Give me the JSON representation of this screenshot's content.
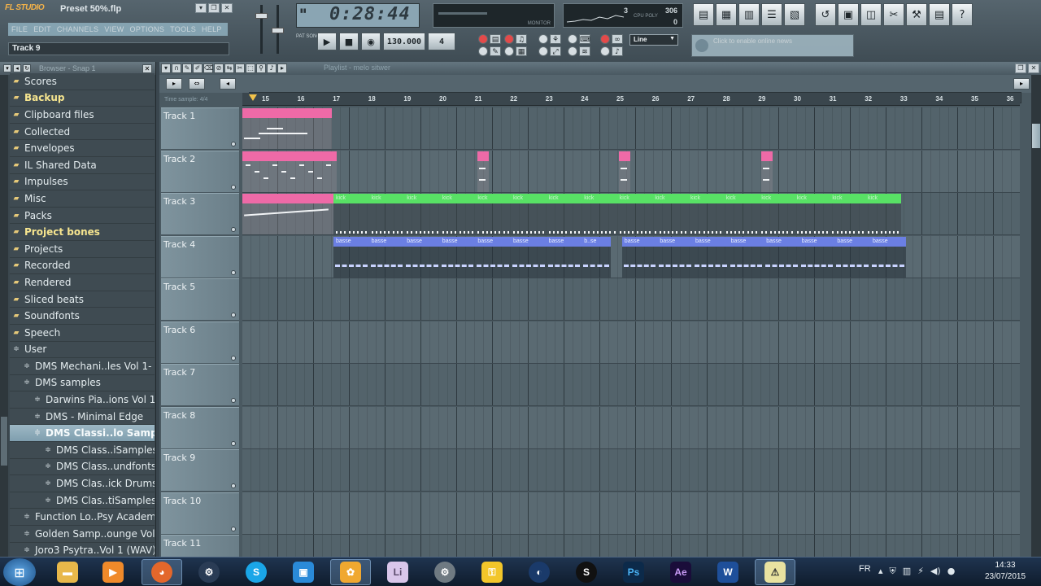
{
  "window": {
    "app_logo": "FL STUDIO",
    "project_title": "Preset 50%.flp",
    "hint_text": "Track 9",
    "menu": [
      "FILE",
      "EDIT",
      "CHANNELS",
      "VIEW",
      "OPTIONS",
      "TOOLS",
      "HELP"
    ]
  },
  "transport": {
    "time": "0:28:44",
    "monitor_label": "MONITOR",
    "cpu_value": "3",
    "ram_value": "306",
    "cpu_label": "CPU POLY",
    "poly_value": "0",
    "pattern_label": "PAT SONG",
    "tempo": "130.000",
    "pattern_number": "4",
    "snap": "Line",
    "news_text": "Click to enable online news"
  },
  "browser": {
    "title": "Browser - Snap 1",
    "items": [
      {
        "label": "Scores",
        "type": "folder",
        "indent": 1
      },
      {
        "label": "Backup",
        "type": "folder",
        "indent": 1,
        "highlight": true
      },
      {
        "label": "Clipboard files",
        "type": "folder",
        "indent": 1
      },
      {
        "label": "Collected",
        "type": "folder",
        "indent": 1
      },
      {
        "label": "Envelopes",
        "type": "folder",
        "indent": 1
      },
      {
        "label": "IL Shared Data",
        "type": "folder",
        "indent": 1
      },
      {
        "label": "Impulses",
        "type": "folder",
        "indent": 1
      },
      {
        "label": "Misc",
        "type": "folder",
        "indent": 1
      },
      {
        "label": "Packs",
        "type": "folder",
        "indent": 1
      },
      {
        "label": "Project bones",
        "type": "folder",
        "indent": 1,
        "highlight": true
      },
      {
        "label": "Projects",
        "type": "folder",
        "indent": 1
      },
      {
        "label": "Recorded",
        "type": "folder",
        "indent": 1
      },
      {
        "label": "Rendered",
        "type": "folder",
        "indent": 1
      },
      {
        "label": "Sliced beats",
        "type": "folder",
        "indent": 1
      },
      {
        "label": "Soundfonts",
        "type": "folder",
        "indent": 1
      },
      {
        "label": "Speech",
        "type": "folder",
        "indent": 1
      },
      {
        "label": "User",
        "type": "open",
        "indent": 1
      },
      {
        "label": "DMS Mechani..les Vol 1- 4",
        "type": "open",
        "indent": 2
      },
      {
        "label": "DMS samples",
        "type": "open",
        "indent": 2
      },
      {
        "label": "Darwins Pia..ions Vol 1",
        "type": "open",
        "indent": 3
      },
      {
        "label": "DMS - Minimal Edge",
        "type": "open",
        "indent": 3
      },
      {
        "label": "DMS Classi..lo Samples",
        "type": "open",
        "indent": 3,
        "selected": true
      },
      {
        "label": "DMS Class..iSamples",
        "type": "open",
        "indent": 4
      },
      {
        "label": "DMS Class..undfonts",
        "type": "open",
        "indent": 4
      },
      {
        "label": "DMS Clas..ick Drums",
        "type": "open",
        "indent": 4
      },
      {
        "label": "DMS Clas..tiSamples",
        "type": "open",
        "indent": 4
      },
      {
        "label": "Function Lo..Psy Academy",
        "type": "open",
        "indent": 2
      },
      {
        "label": "Golden Samp..ounge Vol 2",
        "type": "open",
        "indent": 2
      },
      {
        "label": "Joro3 Psytra..Vol 1 (WAV)",
        "type": "open",
        "indent": 2
      }
    ]
  },
  "playlist": {
    "title": "Playlist - melo sitwer",
    "ruler_label": "Time sample: 4/4",
    "bars": [
      "15",
      "16",
      "17",
      "18",
      "19",
      "20",
      "21",
      "22",
      "23",
      "24",
      "25",
      "26",
      "27",
      "28",
      "29",
      "30",
      "31",
      "32",
      "33",
      "34",
      "35",
      "36"
    ],
    "tracks": [
      {
        "name": "Track 1"
      },
      {
        "name": "Track 2"
      },
      {
        "name": "Track 3"
      },
      {
        "name": "Track 4"
      },
      {
        "name": "Track 5"
      },
      {
        "name": "Track 6"
      },
      {
        "name": "Track 7"
      },
      {
        "name": "Track 8"
      },
      {
        "name": "Track 9"
      },
      {
        "name": "Track 10"
      },
      {
        "name": "Track 11"
      }
    ],
    "clip_labels": {
      "kick": "kick",
      "basse": "basse",
      "bse": "b..se"
    }
  },
  "taskbar": {
    "language": "FR",
    "time": "14:33",
    "date": "23/07/2015",
    "apps": [
      "explorer",
      "media",
      "firefox",
      "steam",
      "skype",
      "app",
      "fl-studio",
      "live",
      "app2",
      "app3",
      "app4",
      "app5",
      "photoshop",
      "after-effects",
      "word",
      "app6"
    ]
  }
}
